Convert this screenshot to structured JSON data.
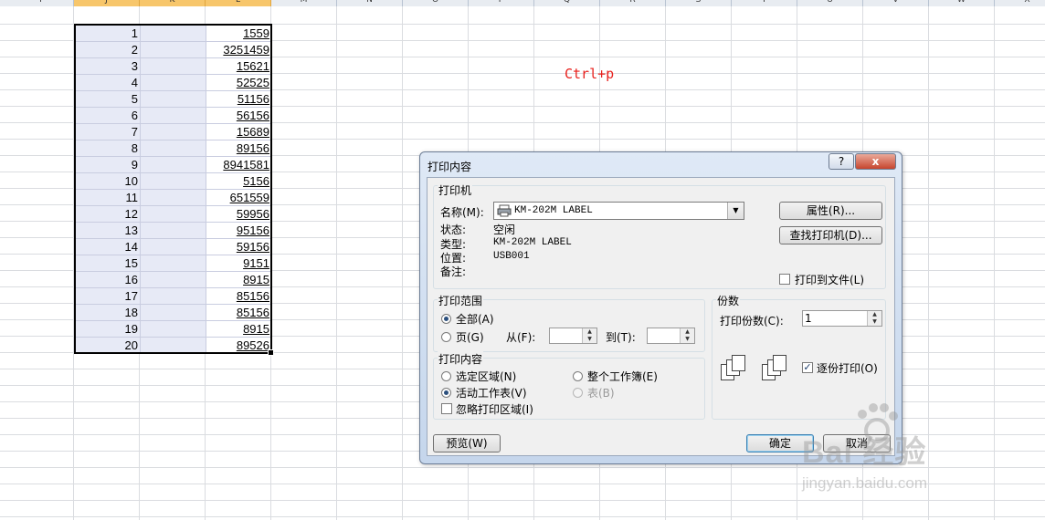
{
  "sheet": {
    "columns": [
      "I",
      "J",
      "K",
      "L",
      "M",
      "N",
      "O",
      "P",
      "Q",
      "R",
      "S",
      "T",
      "U",
      "V",
      "W",
      "X"
    ],
    "selected_columns": [
      "J",
      "K",
      "L"
    ],
    "col_j_values": [
      "1",
      "2",
      "3",
      "4",
      "5",
      "6",
      "7",
      "8",
      "9",
      "10",
      "11",
      "12",
      "13",
      "14",
      "15",
      "16",
      "17",
      "18",
      "19",
      "20"
    ],
    "col_l_values": [
      "1559",
      "3251459",
      "15621",
      "52525",
      "51156",
      "56156",
      "15689",
      "89156",
      "8941581",
      "5156",
      "651559",
      "59956",
      "95156",
      "59156",
      "9151",
      "8915",
      "85156",
      "85156",
      "8915",
      "89526"
    ],
    "annotation": "Ctrl+p"
  },
  "dialog": {
    "title": "打印内容",
    "help_label": "?",
    "close_label": "x",
    "printer_group": {
      "title": "打印机",
      "name_label": "名称(M):",
      "printer_name": "KM-202M LABEL",
      "status_label": "状态:",
      "status_value": "空闲",
      "type_label": "类型:",
      "type_value": "KM-202M LABEL",
      "where_label": "位置:",
      "where_value": "USB001",
      "comment_label": "备注:",
      "properties_button": "属性(R)...",
      "find_printer_button": "查找打印机(D)...",
      "print_to_file_label": "打印到文件(L)",
      "print_to_file_checked": false
    },
    "range_group": {
      "title": "打印范围",
      "all_label": "全部(A)",
      "pages_label": "页(G)",
      "from_label": "从(F):",
      "to_label": "到(T):",
      "selected": "all"
    },
    "what_group": {
      "title": "打印内容",
      "selection_label": "选定区域(N)",
      "active_sheet_label": "活动工作表(V)",
      "ignore_area_label": "忽略打印区域(I)",
      "workbook_label": "整个工作簿(E)",
      "table_label": "表(B)",
      "selected": "active_sheet"
    },
    "copies_group": {
      "title": "份数",
      "copies_label": "打印份数(C):",
      "copies_value": "1",
      "collate_label": "逐份打印(O)",
      "collate_checked": true
    },
    "preview_button": "预览(W)",
    "ok_button": "确定",
    "cancel_button": "取消"
  },
  "watermark": {
    "brand": "Bai 经验",
    "url": "jingyan.baidu.com"
  }
}
